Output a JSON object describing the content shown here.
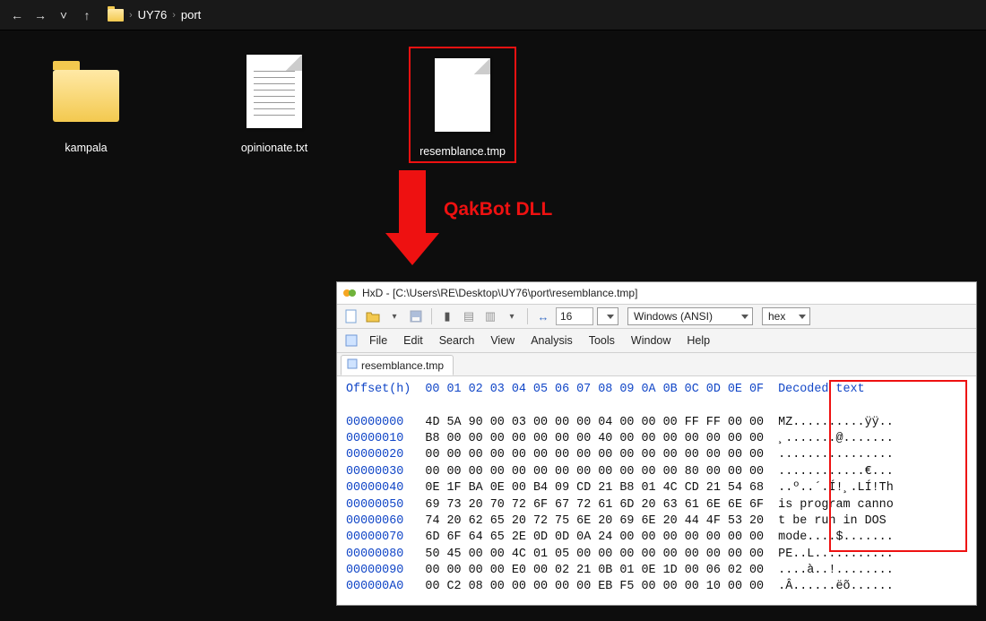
{
  "nav": {
    "crumb1": "UY76",
    "crumb2": "port"
  },
  "files": [
    {
      "name": "kampala",
      "kind": "folder"
    },
    {
      "name": "opinionate.txt",
      "kind": "text"
    },
    {
      "name": "resemblance.tmp",
      "kind": "blank",
      "selected": true
    }
  ],
  "annotation": "QakBot DLL",
  "hxd": {
    "title": "HxD - [C:\\Users\\RE\\Desktop\\UY76\\port\\resemblance.tmp]",
    "cols_value": "16",
    "encoding": "Windows (ANSI)",
    "mode": "hex",
    "menus": [
      "File",
      "Edit",
      "Search",
      "View",
      "Analysis",
      "Tools",
      "Window",
      "Help"
    ],
    "tab": "resemblance.tmp",
    "header_label": "Offset(h)",
    "header_cols": "00 01 02 03 04 05 06 07 08 09 0A 0B 0C 0D 0E 0F",
    "decoded_label": "Decoded text",
    "rows": [
      {
        "off": "00000000",
        "hex": "4D 5A 90 00 03 00 00 00 04 00 00 00 FF FF 00 00",
        "txt": "MZ..........ÿÿ.."
      },
      {
        "off": "00000010",
        "hex": "B8 00 00 00 00 00 00 00 40 00 00 00 00 00 00 00",
        "txt": "¸.......@......."
      },
      {
        "off": "00000020",
        "hex": "00 00 00 00 00 00 00 00 00 00 00 00 00 00 00 00",
        "txt": "................"
      },
      {
        "off": "00000030",
        "hex": "00 00 00 00 00 00 00 00 00 00 00 00 80 00 00 00",
        "txt": "............€..."
      },
      {
        "off": "00000040",
        "hex": "0E 1F BA 0E 00 B4 09 CD 21 B8 01 4C CD 21 54 68",
        "txt": "..º..´.Í!¸.LÍ!Th"
      },
      {
        "off": "00000050",
        "hex": "69 73 20 70 72 6F 67 72 61 6D 20 63 61 6E 6E 6F",
        "txt": "is program canno"
      },
      {
        "off": "00000060",
        "hex": "74 20 62 65 20 72 75 6E 20 69 6E 20 44 4F 53 20",
        "txt": "t be run in DOS "
      },
      {
        "off": "00000070",
        "hex": "6D 6F 64 65 2E 0D 0D 0A 24 00 00 00 00 00 00 00",
        "txt": "mode....$......."
      },
      {
        "off": "00000080",
        "hex": "50 45 00 00 4C 01 05 00 00 00 00 00 00 00 00 00",
        "txt": "PE..L..........."
      },
      {
        "off": "00000090",
        "hex": "00 00 00 00 E0 00 02 21 0B 01 0E 1D 00 06 02 00",
        "txt": "....à..!........"
      },
      {
        "off": "000000A0",
        "hex": "00 C2 08 00 00 00 00 00 EB F5 00 00 00 10 00 00",
        "txt": ".Â......ëõ......"
      }
    ]
  }
}
